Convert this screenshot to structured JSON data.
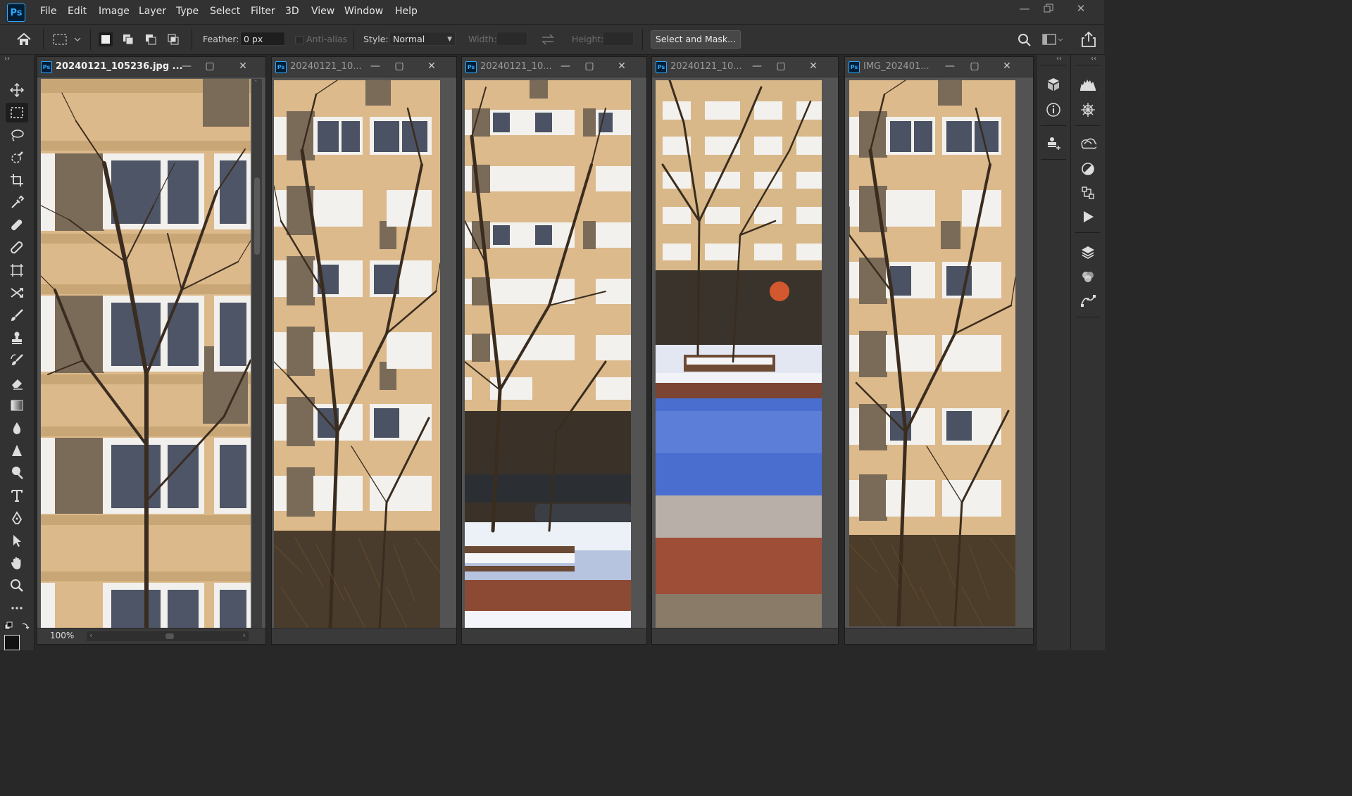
{
  "app": {
    "logo": "Ps"
  },
  "menu": [
    "File",
    "Edit",
    "Image",
    "Layer",
    "Type",
    "Select",
    "Filter",
    "3D",
    "View",
    "Window",
    "Help"
  ],
  "options": {
    "feather_label": "Feather:",
    "feather_value": "0 px",
    "antialias_label": "Anti-alias",
    "style_label": "Style:",
    "style_value": "Normal",
    "width_label": "Width:",
    "height_label": "Height:",
    "select_mask_label": "Select and Mask..."
  },
  "documents": [
    {
      "title": "20240121_105236.jpg ...",
      "active": true
    },
    {
      "title": "20240121_10...",
      "active": false
    },
    {
      "title": "20240121_10...",
      "active": false
    },
    {
      "title": "20240121_10...",
      "active": false
    },
    {
      "title": "IMG_202401...",
      "active": false
    }
  ],
  "status": {
    "zoom": "100%"
  },
  "colors": {
    "ui_bg": "#323232",
    "workspace": "#282828",
    "accent": "#31a8ff",
    "brick": "#d9b98c",
    "snow": "#3f63c9"
  },
  "icons": {
    "toolbar": [
      "move-icon",
      "marquee-icon",
      "lasso-icon",
      "quick-select-icon",
      "crop-icon",
      "eyedropper-icon",
      "healing-icon",
      "brush-bandage-icon",
      "frame-icon",
      "content-aware-move-icon",
      "brush-icon",
      "clone-stamp-icon",
      "history-brush-icon",
      "eraser-icon",
      "gradient-icon",
      "blur-icon",
      "sharpen-icon",
      "dodge-icon",
      "type-icon",
      "pen-icon",
      "path-select-icon",
      "hand-icon",
      "zoom-icon",
      "more-icon"
    ],
    "dock": [
      "3d-icon",
      "info-icon",
      "stamp-icon",
      "histogram-icon",
      "navigator-icon",
      "libraries-icon",
      "adjustments-icon",
      "properties-icon",
      "actions-icon",
      "layers-icon",
      "channels-icon",
      "paths-icon"
    ]
  }
}
